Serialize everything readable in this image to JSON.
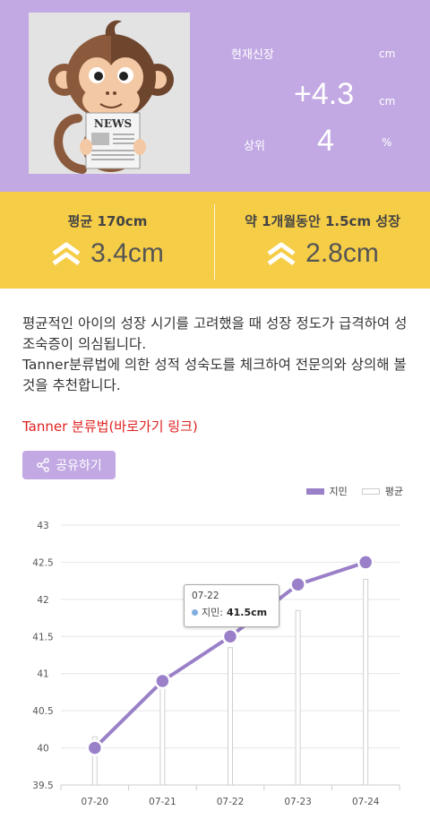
{
  "header": {
    "current_height_label": "현재신장",
    "current_height_unit": "cm",
    "growth_value": "+4.3",
    "growth_unit": "cm",
    "rank_label": "상위",
    "rank_value": "4",
    "rank_unit": "%",
    "avatar_newspaper_text": "NEWS"
  },
  "stats": {
    "left_title": "평균 170cm",
    "left_value": "3.4cm",
    "right_title": "약 1개월동안 1.5cm 성장",
    "right_value": "2.8cm"
  },
  "description": {
    "line1": "평균적인 아이의 성장 시기를 고려했을 때 성장 정도가 급격하여 성조숙증이 의심됩니다.",
    "line2": "Tanner분류법에 의한 성적 성숙도를 체크하여 전문의와 상의해 볼 것을 추천합니다."
  },
  "link_text": "Tanner 분류법(바로가기 링크)",
  "share_label": "공유하기",
  "colors": {
    "accent": "#c2a9e3",
    "yellow": "#f6cd47",
    "line": "#9a80c8",
    "link": "#e02020"
  },
  "tooltip": {
    "date": "07-22",
    "series": "지민:",
    "value": "41.5cm"
  },
  "chart_data": {
    "type": "line",
    "categories": [
      "07-20",
      "07-21",
      "07-22",
      "07-23",
      "07-24"
    ],
    "series": [
      {
        "name": "지민",
        "type": "line",
        "values": [
          40.0,
          40.9,
          41.5,
          42.2,
          42.5
        ]
      },
      {
        "name": "평균",
        "type": "bar",
        "values": [
          40.15,
          40.85,
          41.35,
          41.85,
          42.27
        ]
      }
    ],
    "ylim": [
      39.5,
      43
    ],
    "yticks": [
      "39.5",
      "40",
      "40.5",
      "41",
      "41.5",
      "42",
      "42.5",
      "43"
    ],
    "legend": "top-right",
    "grid": true
  }
}
